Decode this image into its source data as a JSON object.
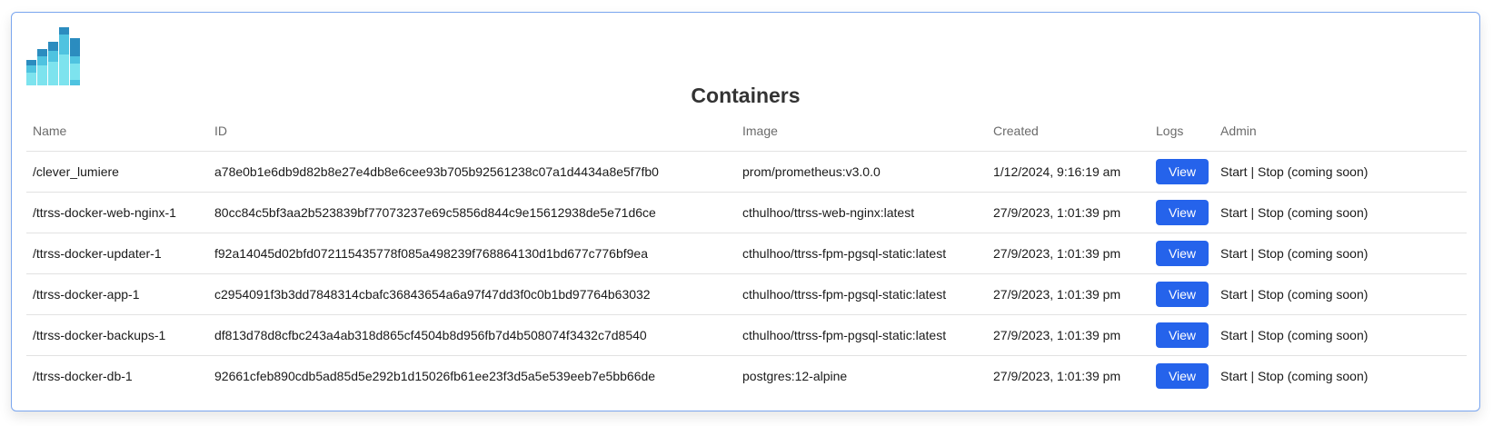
{
  "page": {
    "title": "Containers"
  },
  "logo": {
    "icon": "bar-chart-logo-icon",
    "colors": [
      "#2b8cbf",
      "#4fc3e0",
      "#7de3ee"
    ]
  },
  "table": {
    "headers": {
      "name": "Name",
      "id": "ID",
      "image": "Image",
      "created": "Created",
      "logs": "Logs",
      "admin": "Admin"
    },
    "rows": [
      {
        "name": "/clever_lumiere",
        "id": "a78e0b1e6db9d82b8e27e4db8e6cee93b705b92561238c07a1d4434a8e5f7fb0",
        "image": "prom/prometheus:v3.0.0",
        "created": "1/12/2024, 9:16:19 am",
        "logs_label": "View",
        "start_label": "Start",
        "separator": " | ",
        "stop_label": "Stop (coming soon)"
      },
      {
        "name": "/ttrss-docker-web-nginx-1",
        "id": "80cc84c5bf3aa2b523839bf77073237e69c5856d844c9e15612938de5e71d6ce",
        "image": "cthulhoo/ttrss-web-nginx:latest",
        "created": "27/9/2023, 1:01:39 pm",
        "logs_label": "View",
        "start_label": "Start",
        "separator": " | ",
        "stop_label": "Stop (coming soon)"
      },
      {
        "name": "/ttrss-docker-updater-1",
        "id": "f92a14045d02bfd072115435778f085a498239f768864130d1bd677c776bf9ea",
        "image": "cthulhoo/ttrss-fpm-pgsql-static:latest",
        "created": "27/9/2023, 1:01:39 pm",
        "logs_label": "View",
        "start_label": "Start",
        "separator": " | ",
        "stop_label": "Stop (coming soon)"
      },
      {
        "name": "/ttrss-docker-app-1",
        "id": "c2954091f3b3dd7848314cbafc36843654a6a97f47dd3f0c0b1bd97764b63032",
        "image": "cthulhoo/ttrss-fpm-pgsql-static:latest",
        "created": "27/9/2023, 1:01:39 pm",
        "logs_label": "View",
        "start_label": "Start",
        "separator": " | ",
        "stop_label": "Stop (coming soon)"
      },
      {
        "name": "/ttrss-docker-backups-1",
        "id": "df813d78d8cfbc243a4ab318d865cf4504b8d956fb7d4b508074f3432c7d8540",
        "image": "cthulhoo/ttrss-fpm-pgsql-static:latest",
        "created": "27/9/2023, 1:01:39 pm",
        "logs_label": "View",
        "start_label": "Start",
        "separator": " | ",
        "stop_label": "Stop (coming soon)"
      },
      {
        "name": "/ttrss-docker-db-1",
        "id": "92661cfeb890cdb5ad85d5e292b1d15026fb61ee23f3d5a5e539eeb7e5bb66de",
        "image": "postgres:12-alpine",
        "created": "27/9/2023, 1:01:39 pm",
        "logs_label": "View",
        "start_label": "Start",
        "separator": " | ",
        "stop_label": "Stop (coming soon)"
      }
    ]
  },
  "colors": {
    "accent": "#2563eb",
    "card_border": "#7aa6ef"
  }
}
